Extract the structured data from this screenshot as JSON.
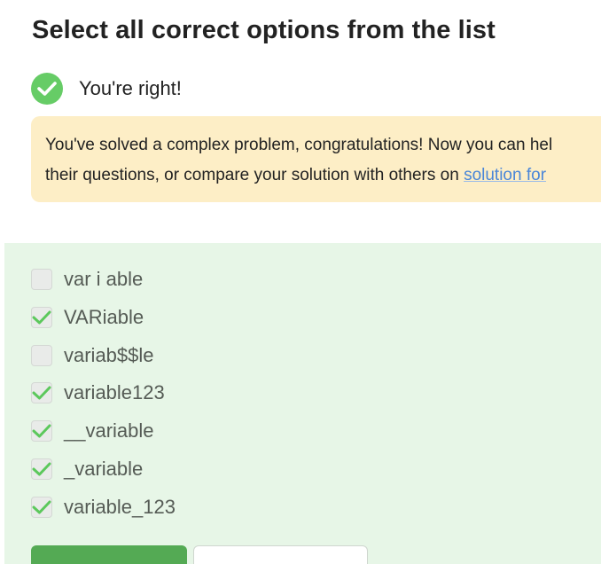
{
  "quiz": {
    "title": "Select all correct options from the list"
  },
  "feedback": {
    "status_text": "You're right!",
    "notice_text": "You've solved a complex problem, congratulations! Now you can hel",
    "notice_text_line2": "their questions, or compare your solution with others on ",
    "notice_link": "solution for"
  },
  "options": [
    {
      "label": "var i able",
      "checked": false
    },
    {
      "label": "VARiable",
      "checked": true
    },
    {
      "label": "variab$$le",
      "checked": false
    },
    {
      "label": "variable123",
      "checked": true
    },
    {
      "label": "__variable",
      "checked": true
    },
    {
      "label": "_variable",
      "checked": true
    },
    {
      "label": "variable_123",
      "checked": true
    }
  ],
  "colors": {
    "accent_green": "#66cc66",
    "panel_green": "#e7f6e7",
    "notice_yellow": "#fdeec6",
    "link_blue": "#4a86d8"
  }
}
